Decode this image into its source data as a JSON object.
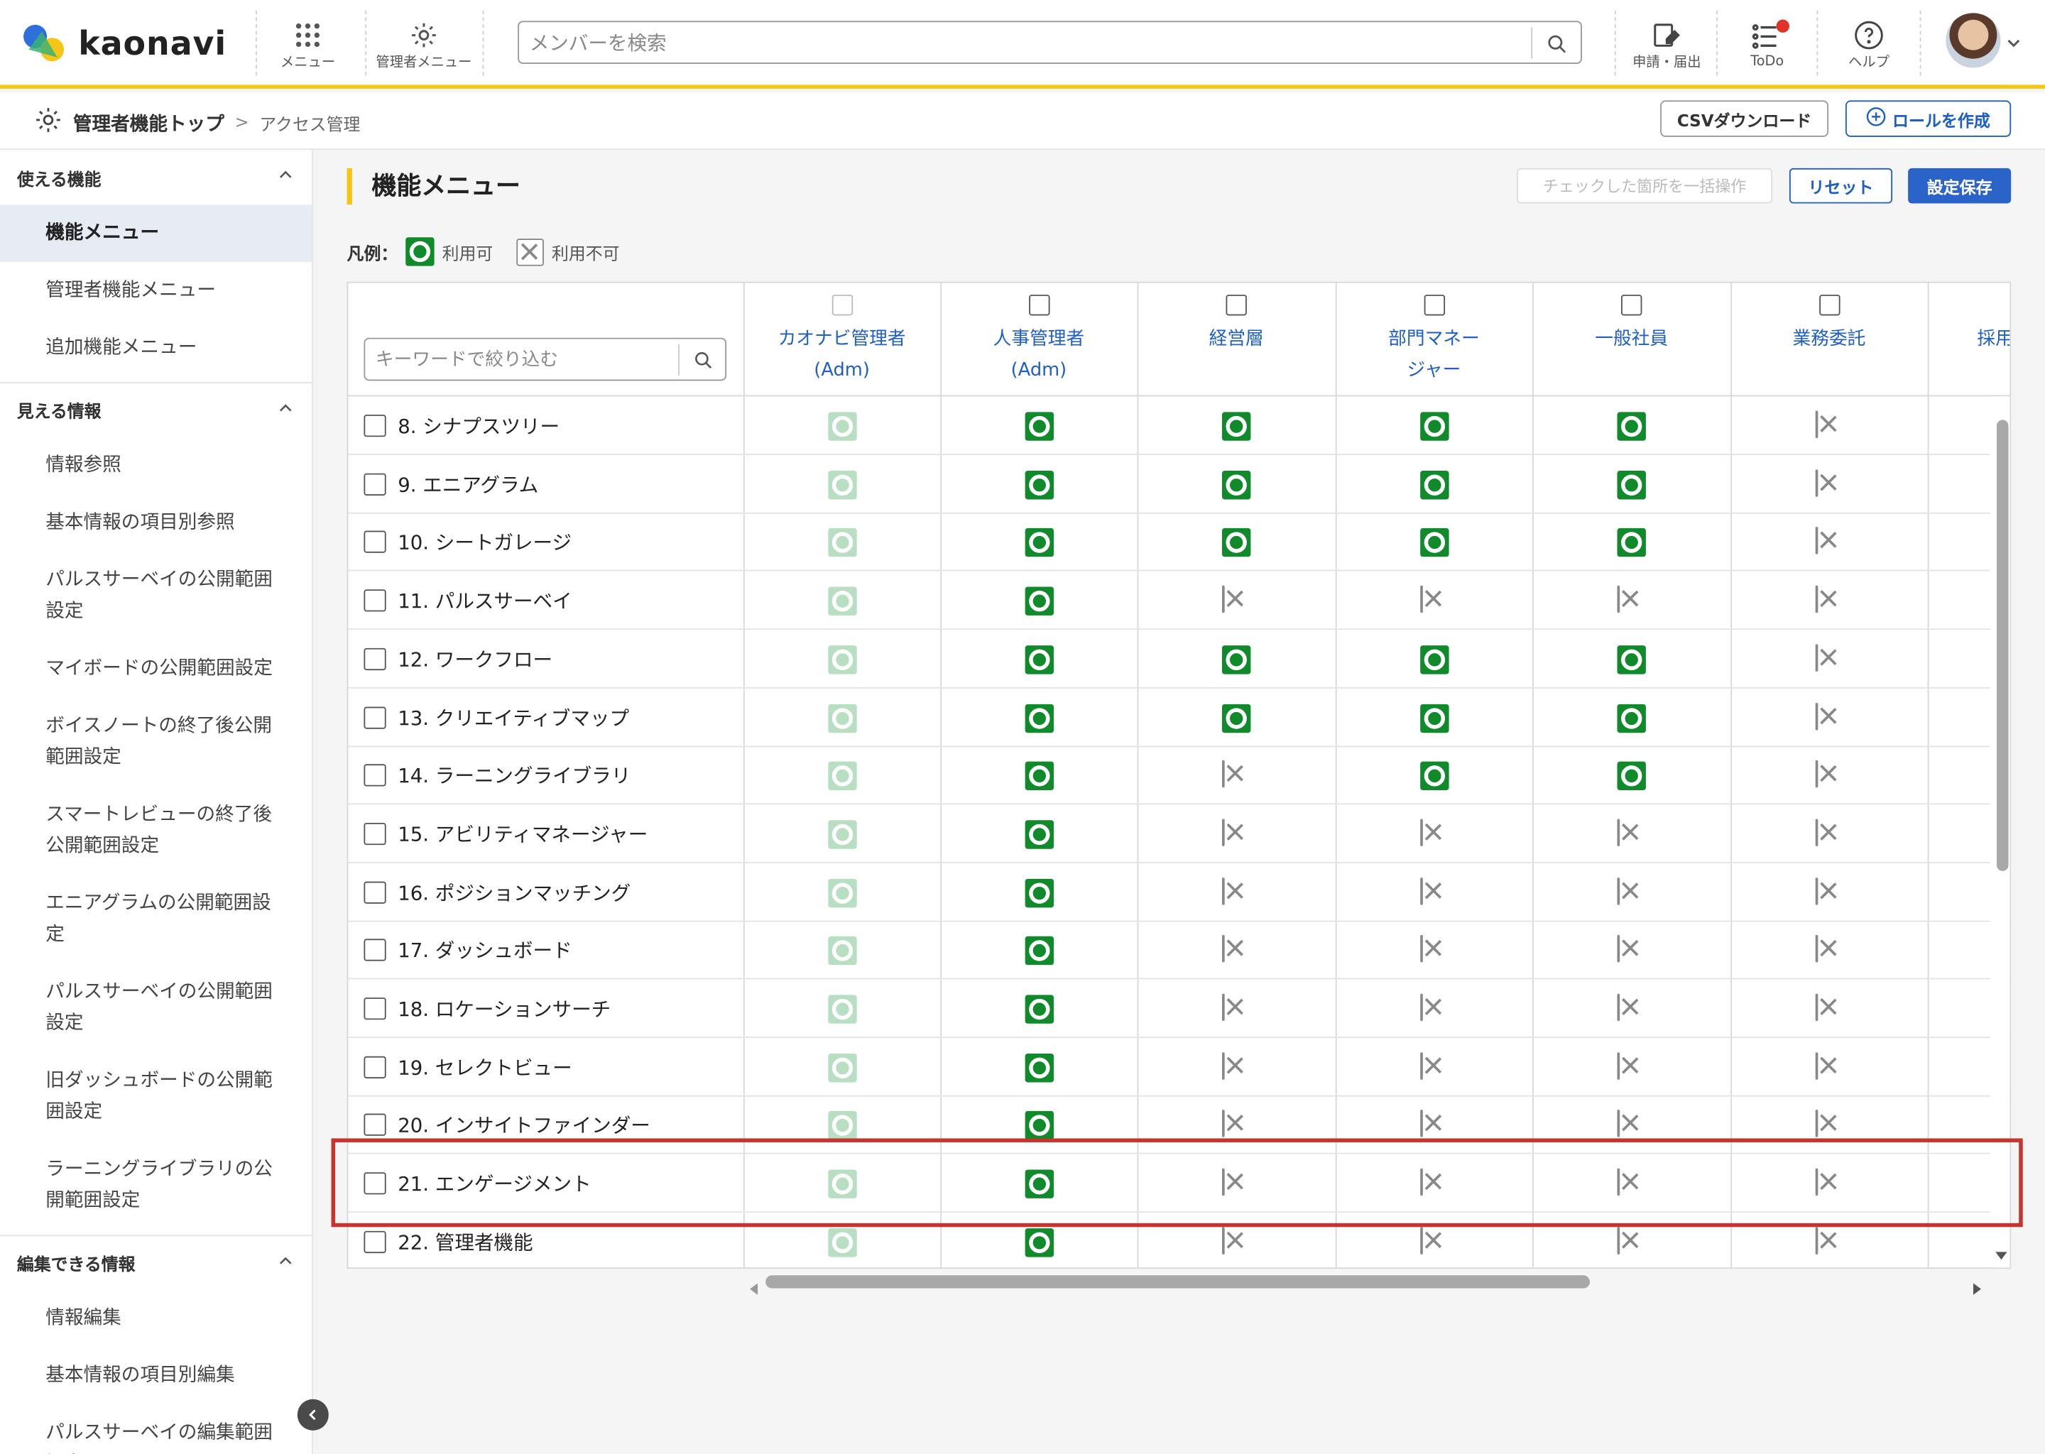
{
  "app": {
    "logo_text": "kaonavi"
  },
  "header": {
    "menu_label": "メニュー",
    "admin_menu_label": "管理者メニュー",
    "search_placeholder": "メンバーを検索",
    "apply_label": "申請・届出",
    "todo_label": "ToDo",
    "help_label": "ヘルプ"
  },
  "breadcrumb": {
    "home": "管理者機能トップ",
    "separator": ">",
    "current": "アクセス管理"
  },
  "actions": {
    "csv_label": "CSVダウンロード",
    "create_role_label": "ロールを作成"
  },
  "sidebar": {
    "sections": [
      {
        "title": "使える機能",
        "items": [
          "機能メニュー",
          "管理者機能メニュー",
          "追加機能メニュー"
        ]
      },
      {
        "title": "見える情報",
        "items": [
          "情報参照",
          "基本情報の項目別参照",
          "パルスサーベイの公開範囲設定",
          "マイボードの公開範囲設定",
          "ボイスノートの終了後公開範囲設定",
          "スマートレビューの終了後公開範囲設定",
          "エニアグラムの公開範囲設定",
          "パルスサーベイの公開範囲設定",
          "旧ダッシュボードの公開範囲設定",
          "ラーニングライブラリの公開範囲設定"
        ]
      },
      {
        "title": "編集できる情報",
        "items": [
          "情報編集",
          "基本情報の項目別編集",
          "パルスサーベイの編集範囲設定"
        ]
      }
    ],
    "active_item": "機能メニュー"
  },
  "main": {
    "title": "機能メニュー",
    "bulk_label": "チェックした箇所を一括操作",
    "reset_label": "リセット",
    "save_label": "設定保存",
    "legend": {
      "prefix": "凡例：",
      "allowed": "利用可",
      "denied": "利用不可"
    },
    "filter_placeholder": "キーワードで絞り込む"
  },
  "table": {
    "roles": [
      "カオナビ管理者\n(Adm)",
      "人事管理者\n(Adm)",
      "経営層",
      "部門マネー\nジャー",
      "一般社員",
      "業務委託",
      "採用"
    ],
    "rows": [
      {
        "label": "8. シナプスツリー",
        "perms": [
          "light",
          "ok",
          "ok",
          "ok",
          "ok",
          "ng"
        ]
      },
      {
        "label": "9. エニアグラム",
        "perms": [
          "light",
          "ok",
          "ok",
          "ok",
          "ok",
          "ng"
        ]
      },
      {
        "label": "10. シートガレージ",
        "perms": [
          "light",
          "ok",
          "ok",
          "ok",
          "ok",
          "ng"
        ]
      },
      {
        "label": "11. パルスサーベイ",
        "perms": [
          "light",
          "ok",
          "ng",
          "ng",
          "ng",
          "ng"
        ]
      },
      {
        "label": "12. ワークフロー",
        "perms": [
          "light",
          "ok",
          "ok",
          "ok",
          "ok",
          "ng"
        ]
      },
      {
        "label": "13. クリエイティブマップ",
        "perms": [
          "light",
          "ok",
          "ok",
          "ok",
          "ok",
          "ng"
        ]
      },
      {
        "label": "14. ラーニングライブラリ",
        "perms": [
          "light",
          "ok",
          "ng",
          "ok",
          "ok",
          "ng"
        ]
      },
      {
        "label": "15. アビリティマネージャー",
        "perms": [
          "light",
          "ok",
          "ng",
          "ng",
          "ng",
          "ng"
        ]
      },
      {
        "label": "16. ポジションマッチング",
        "perms": [
          "light",
          "ok",
          "ng",
          "ng",
          "ng",
          "ng"
        ]
      },
      {
        "label": "17. ダッシュボード",
        "perms": [
          "light",
          "ok",
          "ng",
          "ng",
          "ng",
          "ng"
        ]
      },
      {
        "label": "18. ロケーションサーチ",
        "perms": [
          "light",
          "ok",
          "ng",
          "ng",
          "ng",
          "ng"
        ]
      },
      {
        "label": "19. セレクトビュー",
        "perms": [
          "light",
          "ok",
          "ng",
          "ng",
          "ng",
          "ng"
        ]
      },
      {
        "label": "20. インサイトファインダー",
        "perms": [
          "light",
          "ok",
          "ng",
          "ng",
          "ng",
          "ng"
        ]
      },
      {
        "label": "21. エンゲージメント",
        "perms": [
          "light",
          "ok",
          "ng",
          "ng",
          "ng",
          "ng"
        ]
      },
      {
        "label": "22. 管理者機能",
        "perms": [
          "light",
          "ok",
          "ng",
          "ng",
          "ng",
          "ng"
        ]
      }
    ],
    "highlighted_row": "21. エンゲージメント"
  },
  "colors": {
    "accent": "#f5c518",
    "primary": "#2b64c9",
    "allowed": "#108a2a",
    "highlight": "#c8332c"
  }
}
